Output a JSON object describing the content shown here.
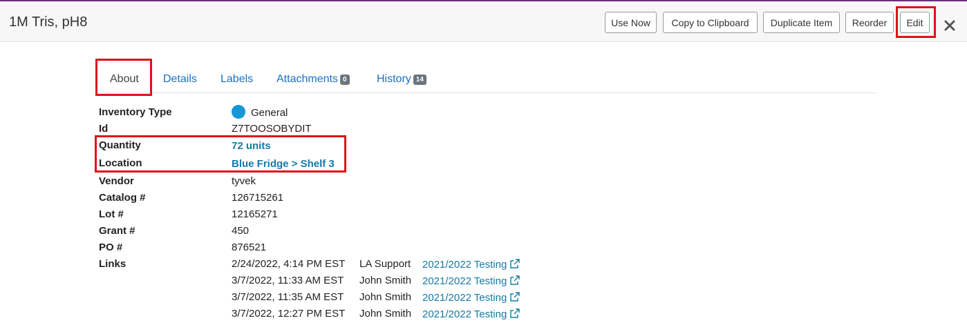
{
  "header": {
    "title": "1M Tris, pH8",
    "buttons": {
      "use_now": "Use Now",
      "copy": "Copy to Clipboard",
      "duplicate": "Duplicate Item",
      "reorder": "Reorder",
      "edit": "Edit"
    },
    "close_icon": "close-icon"
  },
  "tabs": [
    {
      "label": "About",
      "active": true
    },
    {
      "label": "Details"
    },
    {
      "label": "Labels"
    },
    {
      "label": "Attachments",
      "badge": "0"
    },
    {
      "label": "History",
      "badge": "14"
    }
  ],
  "fields": {
    "inventory_type": {
      "label": "Inventory Type",
      "value": "General",
      "dot_color": "#1596d6"
    },
    "id": {
      "label": "Id",
      "value": "Z7TOOSOBYDIT"
    },
    "quantity": {
      "label": "Quantity",
      "value": "72 units"
    },
    "location": {
      "label": "Location",
      "value": "Blue Fridge > Shelf 3"
    },
    "vendor": {
      "label": "Vendor",
      "value": "tyvek"
    },
    "catalog": {
      "label": "Catalog #",
      "value": "126715261"
    },
    "lot": {
      "label": "Lot #",
      "value": "12165271"
    },
    "grant": {
      "label": "Grant #",
      "value": "450"
    },
    "po": {
      "label": "PO #",
      "value": "876521"
    },
    "links_label": "Links"
  },
  "links": [
    {
      "date": "2/24/2022, 4:14 PM EST",
      "user": "LA Support",
      "text": "2021/2022 Testing"
    },
    {
      "date": "3/7/2022, 11:33 AM EST",
      "user": "John Smith",
      "text": "2021/2022 Testing"
    },
    {
      "date": "3/7/2022, 11:35 AM EST",
      "user": "John Smith",
      "text": "2021/2022 Testing"
    },
    {
      "date": "3/7/2022, 12:27 PM EST",
      "user": "John Smith",
      "text": "2021/2022 Testing"
    }
  ],
  "colors": {
    "accent_link": "#137aa6",
    "highlight_box": "#e0101a",
    "tab_link": "#1a6fc4"
  }
}
